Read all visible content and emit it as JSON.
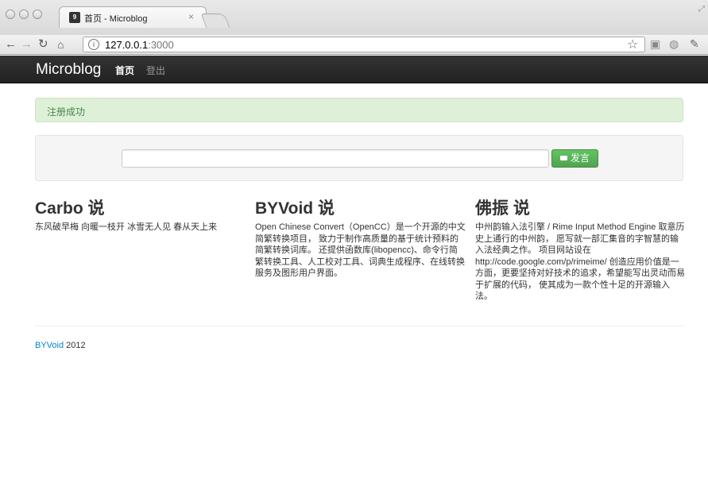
{
  "browser": {
    "tab_title": "首页 - Microblog",
    "tab_close": "×",
    "favicon_text": "9",
    "url_host": "127.0.0.1",
    "url_port": ":3000",
    "icons": [
      "back-arrow-icon",
      "forward-arrow-icon",
      "reload-icon",
      "home-icon",
      "page-info-icon",
      "star-icon",
      "extension-icon",
      "globe-icon",
      "wrench-icon"
    ]
  },
  "navbar": {
    "brand": "Microblog",
    "home_label": "首页",
    "logout_label": "登出"
  },
  "alert": {
    "message": "注册成功",
    "color": "#468847",
    "background": "#dff0d8"
  },
  "post_form": {
    "input_value": "",
    "submit_label": "发言",
    "button_color": "#51a351"
  },
  "posts": [
    {
      "title": "Carbo 说",
      "content": "东风破早梅 向暖一枝开 冰雪无人见 春从天上来"
    },
    {
      "title": "BYVoid 说",
      "content": "Open Chinese Convert（OpenCC）是一个开源的中文简繁转换项目， 致力于制作高质量的基于统计预料的简繁转换词库。 还提供函数库(libopencc)、命令行简繁转换工具、人工校对工具、词典生成程序、在线转换服务及图形用户界面。"
    },
    {
      "title": "佛振 说",
      "content": "中州韵输入法引擎 / Rime Input Method Engine 取意历史上通行的中州韵， 愿写就一部汇集音的字智慧的输入法经典之作。 项目网站设在 http://code.google.com/p/rimeime/ 创造应用价值是一方面，更要坚持对好技术的追求，希望能写出灵动而易于扩展的代码， 使其成为一款个性十足的开源输入法。"
    }
  ],
  "footer": {
    "link_text": "BYVoid",
    "year": "2012",
    "link_color": "#0088cc"
  }
}
